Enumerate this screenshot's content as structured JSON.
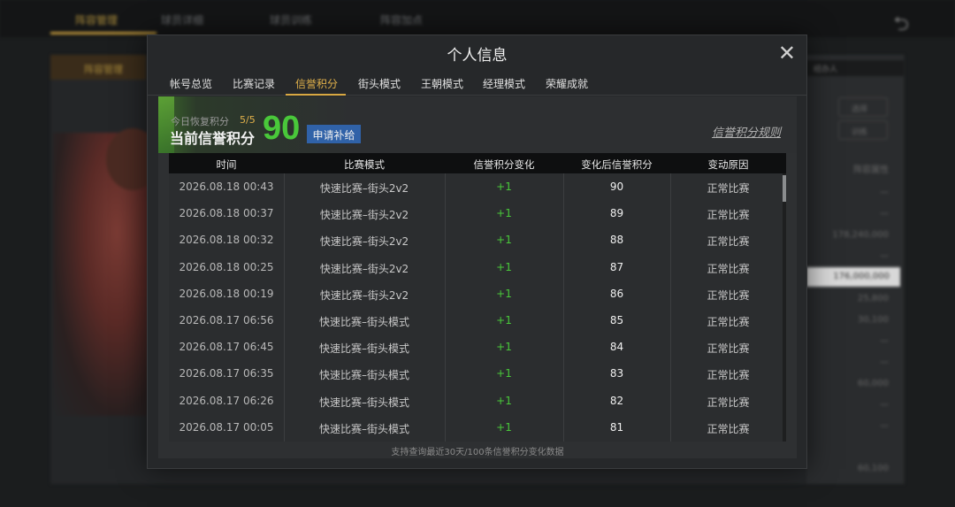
{
  "background": {
    "top_tabs": [
      "阵容管理",
      "球员详细",
      "球员训练",
      "阵容加点"
    ],
    "sub_tab": "阵容管理",
    "dropdown": "经办人",
    "side_buttons": [
      "选择",
      "训练"
    ],
    "side_header": "阵容属性",
    "side_values": [
      "—",
      "—",
      "178,240,000",
      "—",
      "176,000,000",
      "25,800",
      "30,100",
      "—",
      "—",
      "60,000",
      "—",
      "—",
      "60,100"
    ],
    "back_icon": "back-arrow-icon"
  },
  "modal": {
    "title": "个人信息",
    "close_icon": "close-icon",
    "tabs": [
      {
        "label": "帐号总览",
        "active": false
      },
      {
        "label": "比赛记录",
        "active": false
      },
      {
        "label": "信誉积分",
        "active": true
      },
      {
        "label": "街头模式",
        "active": false
      },
      {
        "label": "王朝模式",
        "active": false
      },
      {
        "label": "经理模式",
        "active": false
      },
      {
        "label": "荣耀成就",
        "active": false
      }
    ],
    "active_color": "#e0b04a"
  },
  "credit": {
    "recover_label": "今日恢复积分",
    "recover_count": "5/5",
    "current_label": "当前信誉积分",
    "current_value": "90",
    "value_color": "#49c83a",
    "apply_button": "申请补给",
    "rules_link": "信誉积分规则"
  },
  "table": {
    "headers": [
      "时间",
      "比赛模式",
      "信誉积分变化",
      "变化后信誉积分",
      "变动原因"
    ],
    "rows": [
      {
        "time": "2026.08.18  00:43",
        "mode": "快速比赛–街头2v2",
        "delta": "+1",
        "after": "90",
        "reason": "正常比赛"
      },
      {
        "time": "2026.08.18  00:37",
        "mode": "快速比赛–街头2v2",
        "delta": "+1",
        "after": "89",
        "reason": "正常比赛"
      },
      {
        "time": "2026.08.18  00:32",
        "mode": "快速比赛–街头2v2",
        "delta": "+1",
        "after": "88",
        "reason": "正常比赛"
      },
      {
        "time": "2026.08.18  00:25",
        "mode": "快速比赛–街头2v2",
        "delta": "+1",
        "after": "87",
        "reason": "正常比赛"
      },
      {
        "time": "2026.08.18  00:19",
        "mode": "快速比赛–街头2v2",
        "delta": "+1",
        "after": "86",
        "reason": "正常比赛"
      },
      {
        "time": "2026.08.17  06:56",
        "mode": "快速比赛–街头模式",
        "delta": "+1",
        "after": "85",
        "reason": "正常比赛"
      },
      {
        "time": "2026.08.17  06:45",
        "mode": "快速比赛–街头模式",
        "delta": "+1",
        "after": "84",
        "reason": "正常比赛"
      },
      {
        "time": "2026.08.17  06:35",
        "mode": "快速比赛–街头模式",
        "delta": "+1",
        "after": "83",
        "reason": "正常比赛"
      },
      {
        "time": "2026.08.17  06:26",
        "mode": "快速比赛–街头模式",
        "delta": "+1",
        "after": "82",
        "reason": "正常比赛"
      },
      {
        "time": "2026.08.17  00:05",
        "mode": "快速比赛–街头模式",
        "delta": "+1",
        "after": "81",
        "reason": "正常比赛"
      }
    ],
    "footer_note": "支持查询最近30天/100条信誉积分变化数据"
  }
}
